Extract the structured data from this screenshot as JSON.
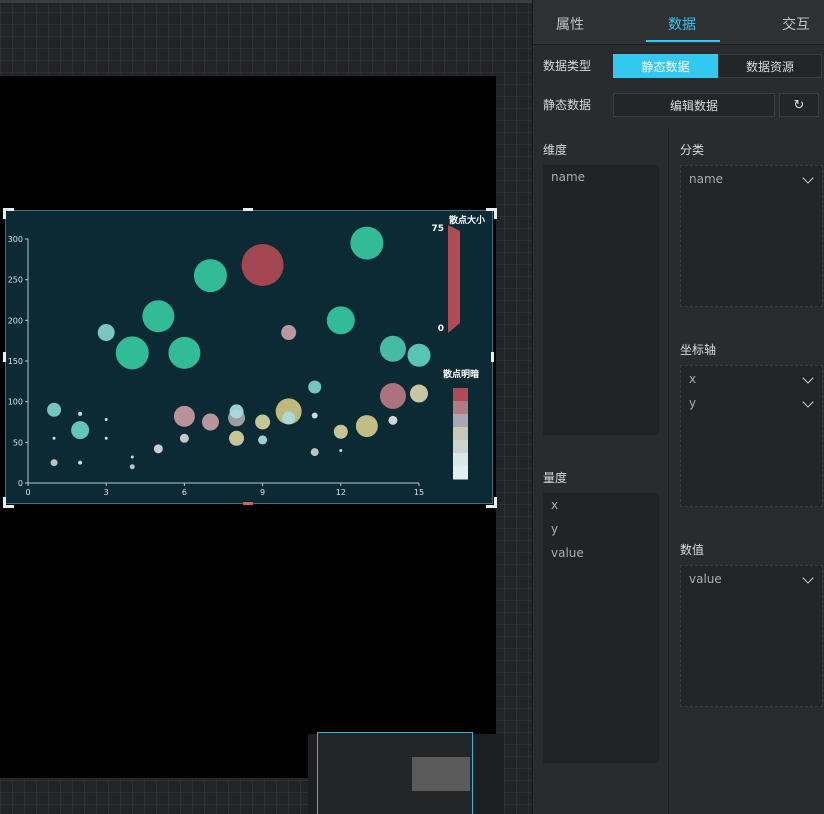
{
  "tabs": [
    {
      "label": "属性"
    },
    {
      "label": "数据"
    },
    {
      "label": "交互"
    }
  ],
  "data_type": {
    "label": "数据类型",
    "options": [
      "静态数据",
      "数据资源"
    ],
    "selected": "静态数据"
  },
  "static_data": {
    "label": "静态数据",
    "edit_label": "编辑数据",
    "refresh_icon": "↻"
  },
  "dimensions": {
    "title": "维度",
    "items": [
      "name"
    ]
  },
  "measures": {
    "title": "量度",
    "items": [
      "x",
      "y",
      "value"
    ]
  },
  "category": {
    "title": "分类",
    "fields": [
      "name"
    ]
  },
  "axis": {
    "title": "坐标轴",
    "fields": [
      "x",
      "y"
    ]
  },
  "value_field": {
    "title": "数值",
    "fields": [
      "value"
    ]
  },
  "chart_data": {
    "type": "scatter",
    "xlim": [
      0,
      15
    ],
    "ylim": [
      0,
      300
    ],
    "xticks": [
      "0",
      "3",
      "6",
      "9",
      "12",
      "15"
    ],
    "yticks": [
      "0",
      "50",
      "100",
      "150",
      "200",
      "250",
      "300"
    ],
    "size_legend": {
      "title": "散点大小",
      "max": "75",
      "min": "0"
    },
    "color_legend": {
      "title": "散点明暗"
    },
    "colors": [
      "#b04a55",
      "#b07a86",
      "#a9a7b2",
      "#c9c7b9",
      "#cfd3cf",
      "#dbe6e6",
      "#e3eef1"
    ],
    "points": [
      {
        "x": 1,
        "y": 90,
        "v": 14,
        "c": "#7ed4cb"
      },
      {
        "x": 1,
        "y": 55,
        "v": 3,
        "c": "#dfe7e8"
      },
      {
        "x": 1,
        "y": 25,
        "v": 7,
        "c": "#c9d0cf"
      },
      {
        "x": 2,
        "y": 65,
        "v": 18,
        "c": "#6fd2c6"
      },
      {
        "x": 2,
        "y": 85,
        "v": 4,
        "c": "#dfe7e8"
      },
      {
        "x": 2,
        "y": 25,
        "v": 4,
        "c": "#dfe7e8"
      },
      {
        "x": 3,
        "y": 78,
        "v": 3,
        "c": "#dfe7e8"
      },
      {
        "x": 3,
        "y": 55,
        "v": 3,
        "c": "#dfe7e8"
      },
      {
        "x": 3,
        "y": 185,
        "v": 17,
        "c": "#86d4cb"
      },
      {
        "x": 4,
        "y": 160,
        "v": 33,
        "c": "#35c8a0"
      },
      {
        "x": 4,
        "y": 32,
        "v": 3,
        "c": "#dfe7e8"
      },
      {
        "x": 4,
        "y": 20,
        "v": 5,
        "c": "#c9d0cf"
      },
      {
        "x": 5,
        "y": 205,
        "v": 32,
        "c": "#35c8a0"
      },
      {
        "x": 5,
        "y": 42,
        "v": 9,
        "c": "#d8dcdb"
      },
      {
        "x": 6,
        "y": 160,
        "v": 32,
        "c": "#35c8a0"
      },
      {
        "x": 6,
        "y": 82,
        "v": 21,
        "c": "#c99aa3"
      },
      {
        "x": 6,
        "y": 55,
        "v": 9,
        "c": "#d2d7d4"
      },
      {
        "x": 7,
        "y": 255,
        "v": 33,
        "c": "#35c8a0"
      },
      {
        "x": 7,
        "y": 75,
        "v": 17,
        "c": "#c79ea5"
      },
      {
        "x": 8,
        "y": 80,
        "v": 17,
        "c": "#a7a8a8"
      },
      {
        "x": 8,
        "y": 88,
        "v": 14,
        "c": "#a9dde0"
      },
      {
        "x": 8,
        "y": 55,
        "v": 15,
        "c": "#d8d39e"
      },
      {
        "x": 9,
        "y": 268,
        "v": 42,
        "c": "#b04a55"
      },
      {
        "x": 9,
        "y": 75,
        "v": 15,
        "c": "#d8d39e"
      },
      {
        "x": 9,
        "y": 53,
        "v": 9,
        "c": "#a9dde0"
      },
      {
        "x": 10,
        "y": 88,
        "v": 26,
        "c": "#cfc683"
      },
      {
        "x": 10,
        "y": 80,
        "v": 13,
        "c": "#a9dde0"
      },
      {
        "x": 10,
        "y": 185,
        "v": 15,
        "c": "#c9a2ab"
      },
      {
        "x": 11,
        "y": 118,
        "v": 13,
        "c": "#7ed4cb"
      },
      {
        "x": 11,
        "y": 83,
        "v": 6,
        "c": "#dfe7e8"
      },
      {
        "x": 11,
        "y": 38,
        "v": 8,
        "c": "#c9d0cf"
      },
      {
        "x": 12,
        "y": 200,
        "v": 28,
        "c": "#35c8a0"
      },
      {
        "x": 12,
        "y": 63,
        "v": 14,
        "c": "#d8d39e"
      },
      {
        "x": 12,
        "y": 40,
        "v": 3,
        "c": "#dfe7e8"
      },
      {
        "x": 13,
        "y": 295,
        "v": 33,
        "c": "#35c8a0"
      },
      {
        "x": 13,
        "y": 70,
        "v": 22,
        "c": "#d2ca8c"
      },
      {
        "x": 14,
        "y": 165,
        "v": 26,
        "c": "#4cc8ad"
      },
      {
        "x": 14,
        "y": 107,
        "v": 26,
        "c": "#b87983"
      },
      {
        "x": 14,
        "y": 77,
        "v": 9,
        "c": "#dfe7e8"
      },
      {
        "x": 15,
        "y": 157,
        "v": 23,
        "c": "#60d1bd"
      },
      {
        "x": 15,
        "y": 110,
        "v": 18,
        "c": "#d7d4ab"
      }
    ]
  }
}
